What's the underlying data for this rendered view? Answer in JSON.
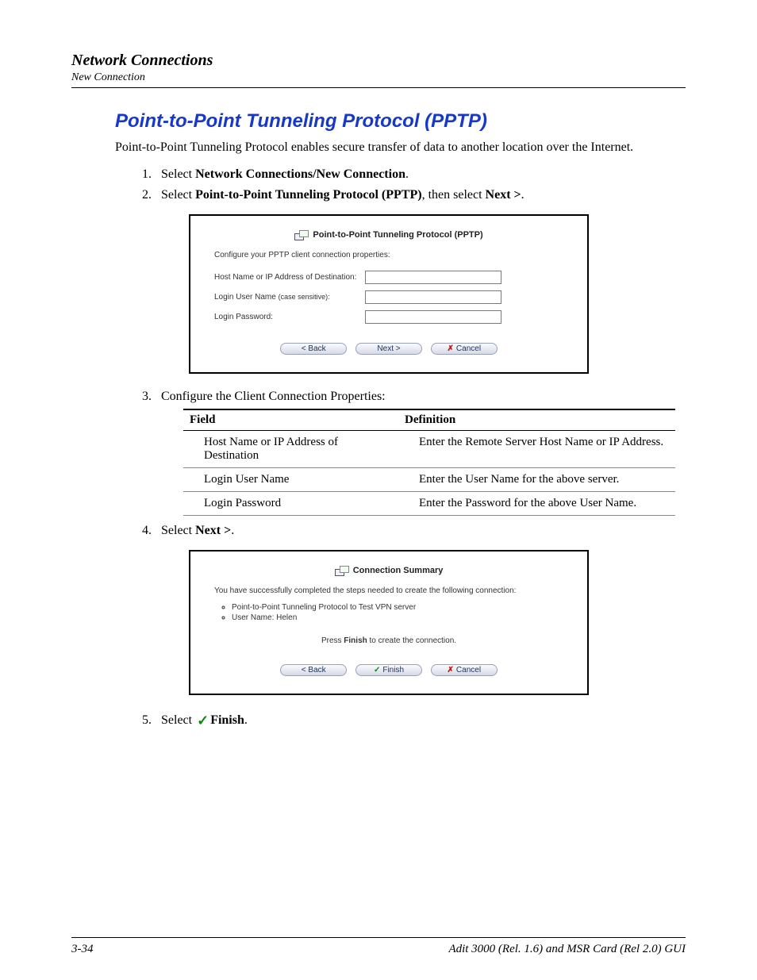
{
  "header": {
    "title": "Network Connections",
    "subtitle": "New Connection"
  },
  "section": {
    "title": "Point-to-Point Tunneling Protocol (PPTP)",
    "intro": "Point-to-Point Tunneling Protocol enables secure transfer of data to another location over the Internet."
  },
  "step1": {
    "prefix": "Select ",
    "bold": "Network Connections/New Connection",
    "suffix": "."
  },
  "step2": {
    "prefix": "Select ",
    "bold1": "Point-to-Point Tunneling Protocol (PPTP)",
    "mid": ", then select ",
    "bold2": "Next >",
    "suffix": "."
  },
  "dlg1": {
    "title": "Point-to-Point Tunneling Protocol (PPTP)",
    "desc": "Configure your PPTP client connection properties:",
    "f1": "Host Name or IP Address of Destination:",
    "f2a": "Login User Name ",
    "f2b": "(case sensitive):",
    "f3": "Login Password:",
    "back": "< Back",
    "next": "Next >",
    "cancel": "Cancel"
  },
  "step3": "Configure the Client Connection Properties:",
  "table": {
    "h1": "Field",
    "h2": "Definition",
    "r1c1": "Host Name or IP Address of Destination",
    "r1c2": "Enter the Remote Server Host Name or IP Address.",
    "r2c1": "Login User Name",
    "r2c2": "Enter the User Name for the above server.",
    "r3c1": "Login Password",
    "r3c2": "Enter the Password for the above User Name."
  },
  "step4": {
    "prefix": "Select ",
    "bold": "Next >",
    "suffix": "."
  },
  "dlg2": {
    "title": "Connection Summary",
    "msg": "You have successfully completed the steps needed to create the following connection:",
    "li1": "Point-to-Point Tunneling Protocol to Test VPN server",
    "li2": "User Name: Helen",
    "press_a": "Press ",
    "press_b": "Finish",
    "press_c": " to create the connection.",
    "back": "< Back",
    "finish": "Finish",
    "cancel": "Cancel"
  },
  "step5": {
    "prefix": "Select ",
    "bold": "Finish",
    "suffix": "."
  },
  "footer": {
    "left": "3-34",
    "right": "Adit 3000 (Rel. 1.6) and MSR Card (Rel 2.0) GUI"
  }
}
